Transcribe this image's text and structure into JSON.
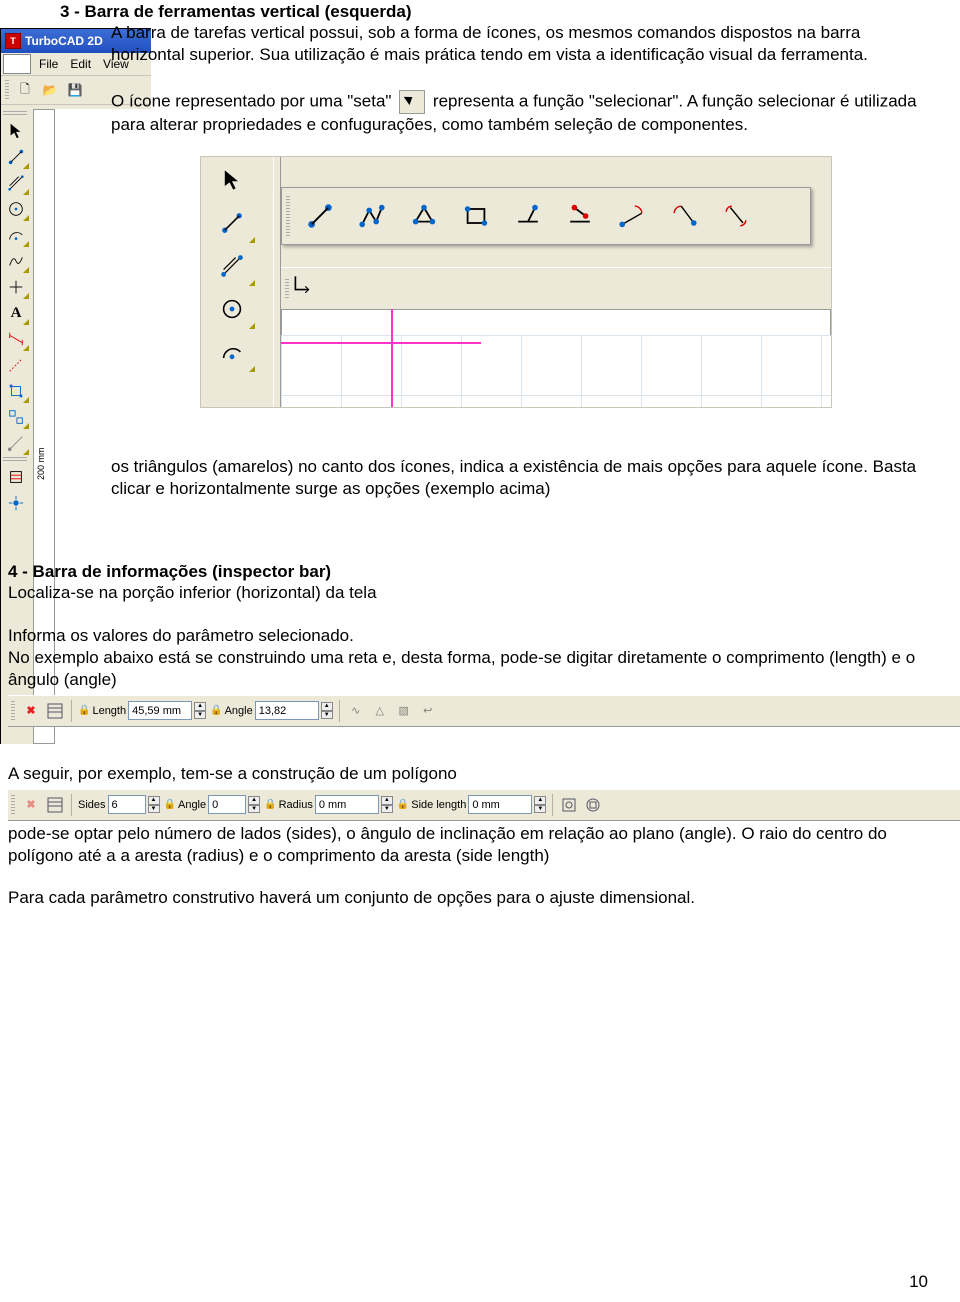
{
  "section3": {
    "title": "3 - Barra de ferramentas vertical (esquerda)",
    "p1": "A barra de tarefas vertical possui, sob a forma de ícones, os mesmos comandos dispostos na barra horizontal superior. Sua utilização é mais prática tendo em vista a identificação visual da ferramenta.",
    "p2a": "O ícone representado por uma \"seta\" ",
    "p2b": " representa a função \"selecionar\". A função selecionar é utilizada para alterar propriedades e confugurações, como também seleção de componentes.",
    "p3": "os triângulos (amarelos) no canto dos ícones, indica a existência de mais opções para aquele ícone. Basta clicar e horizontalmente surge as opções (exemplo acima)"
  },
  "section4": {
    "title": "4 - Barra de informações (inspector bar)",
    "p1": "Localiza-se na porção inferior (horizontal) da tela",
    "p2": "Informa os valores do parâmetro selecionado.",
    "p3": "No exemplo abaixo está  se construindo uma reta e, desta forma, pode-se digitar diretamente o comprimento (length) e o ângulo (angle)",
    "p4": "A seguir, por exemplo, tem-se a construção de um polígono",
    "p5": "pode-se optar pelo número de lados (sides), o ângulo de inclinação em relação ao plano (angle). O raio do centro do polígono até a a aresta (radius) e o comprimento da aresta (side length)",
    "p6": "Para cada parâmetro construtivo haverá um conjunto de opções para o ajuste dimensional."
  },
  "turbocad": {
    "title": "TurboCAD 2D",
    "menus": [
      "File",
      "Edit",
      "View"
    ],
    "ruler_unit": "200 mm"
  },
  "inspector_line": {
    "length_label": "Length",
    "length_value": "45,59 mm",
    "angle_label": "Angle",
    "angle_value": "13,82"
  },
  "inspector_polygon": {
    "sides_label": "Sides",
    "sides_value": "6",
    "angle_label": "Angle",
    "angle_value": "0",
    "radius_label": "Radius",
    "radius_value": "0 mm",
    "sidelen_label": "Side length",
    "sidelen_value": "0 mm"
  },
  "page_number": "10"
}
